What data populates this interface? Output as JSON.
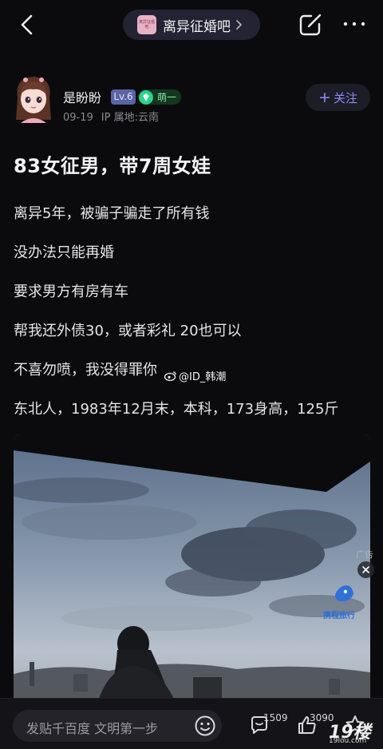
{
  "forum": {
    "name": "离异征婚吧",
    "avatar_text": "离异征婚吧"
  },
  "author": {
    "name": "是盼盼",
    "level": "Lv.6",
    "title_badge": "萌一",
    "date": "09-19",
    "ip_location": "IP 属地:云南",
    "follow_label": "关注"
  },
  "post": {
    "title": "83女征男，带7周女娃",
    "paragraphs": [
      "离异5年，被骗子骗走了所有钱",
      "没办法只能再婚",
      "要求男方有房有车",
      "帮我还外债30，或者彩礼 20也可以",
      "不喜勿喷，我没得罪你",
      "东北人，1983年12月末，本科，173身高，125斤"
    ],
    "watermark": "@ID_韩潮"
  },
  "ad": {
    "label": "广告",
    "brand_text": "携程旅行"
  },
  "bottom": {
    "reply_placeholder": "发贴千百度 文明第一步",
    "comment_count": "1509",
    "like_count": "3090"
  },
  "corner_logo": {
    "main": "19楼",
    "sub": "19lou.com"
  },
  "icons": [
    "back-icon",
    "chevron-right-icon",
    "share-icon",
    "more-icon",
    "plus-icon",
    "weibo-icon",
    "close-icon",
    "emoji-icon",
    "comment-icon",
    "like-icon",
    "favorite-icon"
  ],
  "colors": {
    "background": "#0b0b0d",
    "accent": "#8a8ff5",
    "level_badge": "#5b63a4",
    "title_badge": "#2bd28a"
  }
}
